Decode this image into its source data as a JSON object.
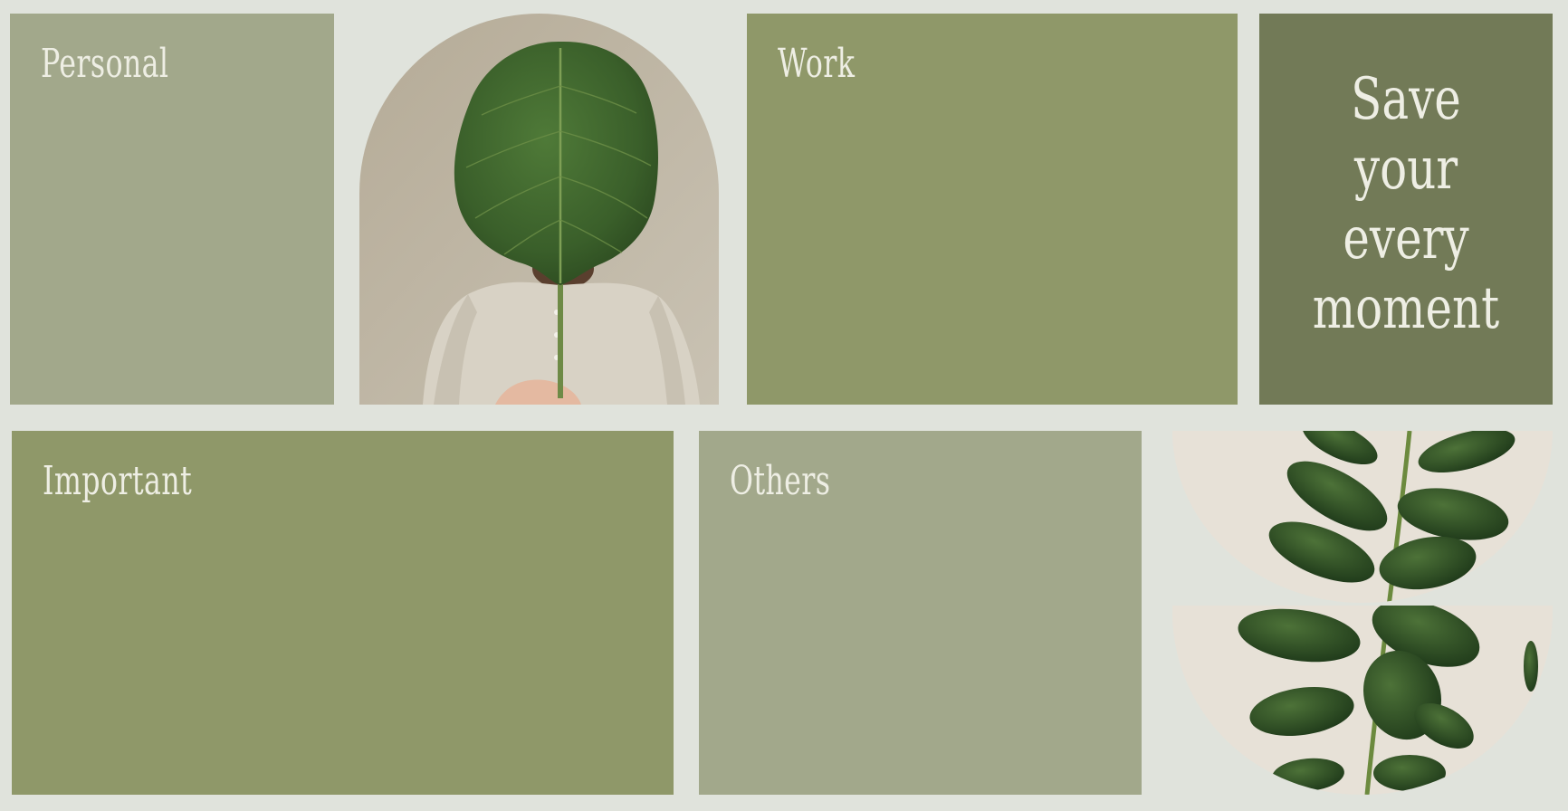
{
  "panels": {
    "personal": "Personal",
    "work": "Work",
    "important": "Important",
    "others": "Others"
  },
  "quote": [
    "Save",
    "your",
    "every",
    "moment"
  ],
  "colors": {
    "background": "#e0e3dc",
    "sage_light": "#a2a88b",
    "olive": "#8f9869",
    "olive_dark": "#727a57",
    "text": "#eeeee4"
  }
}
